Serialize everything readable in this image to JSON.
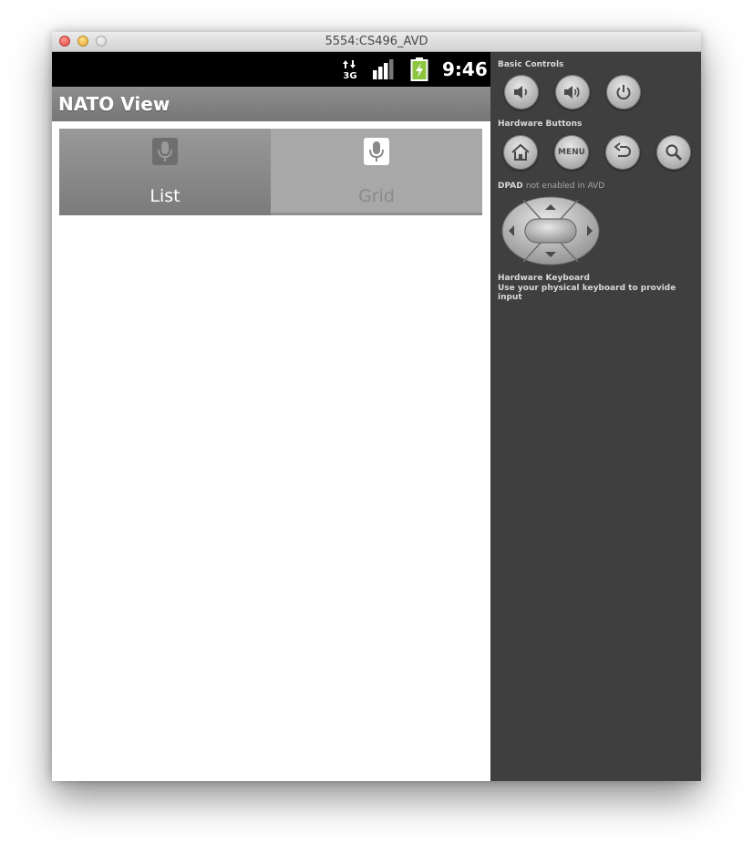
{
  "window": {
    "title": "5554:CS496_AVD"
  },
  "statusbar": {
    "network": "3G",
    "time": "9:46"
  },
  "actionbar": {
    "title": "NATO View"
  },
  "tabs": [
    {
      "label": "List",
      "selected": true,
      "icon": "microphone-icon"
    },
    {
      "label": "Grid",
      "selected": false,
      "icon": "microphone-icon"
    }
  ],
  "controls": {
    "basic_label": "Basic Controls",
    "hardware_label": "Hardware Buttons",
    "menu_label": "MENU",
    "dpad_label": "DPAD",
    "dpad_note": "not enabled in AVD",
    "keyboard_label": "Hardware Keyboard",
    "keyboard_note": "Use your physical keyboard to provide input"
  },
  "colors": {
    "panel_bg": "#3f3f3f",
    "battery_accent": "#8cc63f"
  }
}
